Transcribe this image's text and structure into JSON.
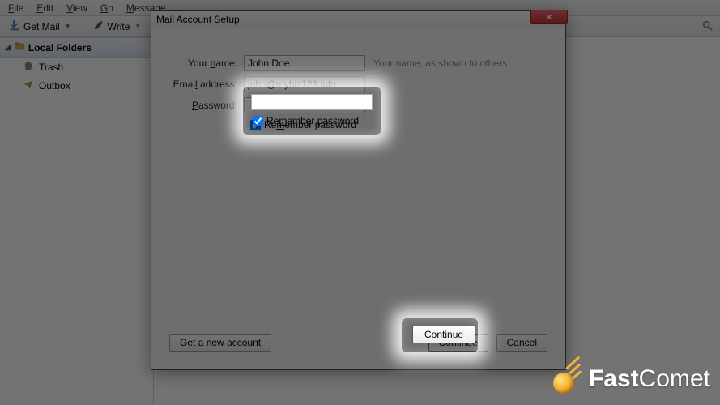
{
  "menubar": {
    "file": "File",
    "edit": "Edit",
    "view": "View",
    "go": "Go",
    "message": "Message"
  },
  "toolbar": {
    "get_mail": "Get Mail",
    "write": "Write"
  },
  "sidebar": {
    "header": "Local Folders",
    "items": [
      {
        "label": "Trash"
      },
      {
        "label": "Outbox"
      }
    ]
  },
  "dialog": {
    "title": "Mail Account Setup",
    "name_label": "Your name:",
    "name_value": "John Doe",
    "name_hint": "Your name, as shown to others",
    "email_label": "Email address:",
    "email_value": "john@mybiz123.info",
    "password_label": "Password:",
    "password_value": "",
    "remember_label": "Remember password",
    "get_account": "Get a new account",
    "continue": "Continue",
    "cancel": "Cancel"
  },
  "watermark": {
    "brand_a": "Fast",
    "brand_b": "Comet"
  }
}
